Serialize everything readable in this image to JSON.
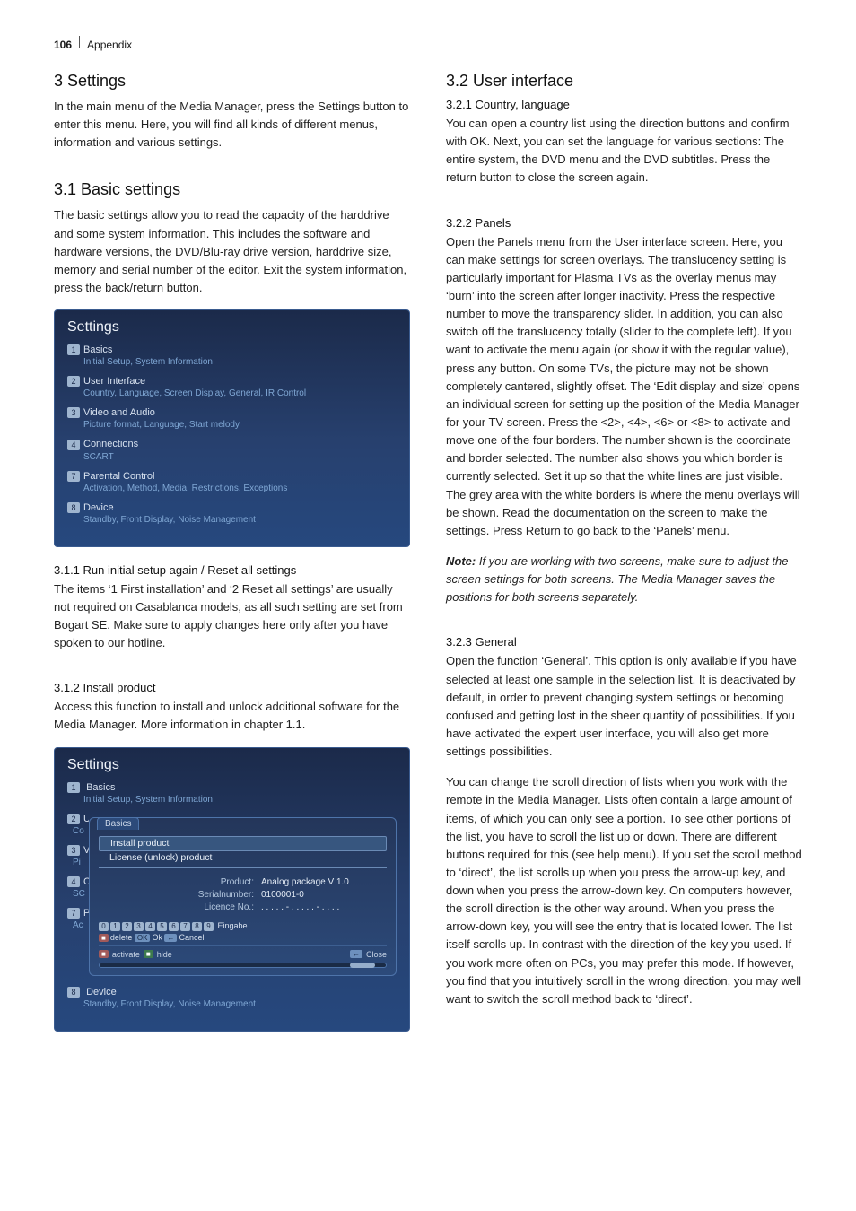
{
  "header": {
    "page_no": "106",
    "section": "Appendix"
  },
  "left": {
    "h_settings": "3 Settings",
    "p_settings": "In the main menu of the Media Manager, press the Settings button to enter this menu. Here, you will find all kinds of different menus, information and various settings.",
    "h_basic": "3.1 Basic settings",
    "p_basic": "The basic settings allow you to read the capacity of the harddrive and some system information. This includes the software and hardware versions, the DVD/Blu-ray drive version, harddrive size, memory and serial number of the editor. Exit the system information, press the back/return button.",
    "panel1": {
      "title": "Settings",
      "items": [
        {
          "num": "1",
          "head": "Basics",
          "sub": "Initial Setup, System Information"
        },
        {
          "num": "2",
          "head": "User Interface",
          "sub": "Country, Language, Screen Display, General, IR Control"
        },
        {
          "num": "3",
          "head": "Video and Audio",
          "sub": "Picture format, Language, Start melody"
        },
        {
          "num": "4",
          "head": "Connections",
          "sub": "SCART"
        },
        {
          "num": "7",
          "head": "Parental Control",
          "sub": "Activation, Method, Media, Restrictions, Exceptions"
        },
        {
          "num": "8",
          "head": "Device",
          "sub": "Standby, Front Display, Noise Management"
        }
      ]
    },
    "h_311": "3.1.1 Run initial setup again / Reset all settings",
    "p_311": "The items ‘1 First installation’ and ‘2 Reset all settings’ are usually not required on Casablanca models, as all such setting are set from Bogart SE. Make sure to apply changes here only after you have spoken to our hotline.",
    "h_312": "3.1.2 Install product",
    "p_312": "Access this function to install and unlock additional software for the Media Manager. More information in chapter 1.1.",
    "panel2": {
      "title": "Settings",
      "item1": {
        "num": "1",
        "head": "Basics",
        "sub": "Initial Setup, System Information"
      },
      "trunc2": {
        "num": "2",
        "headpart": "Us",
        "subpart": "Co"
      },
      "trunc3": {
        "num": "3",
        "headpart": "Vi",
        "subpart": "Pi"
      },
      "trunc4": {
        "num": "4",
        "headpart": "Co",
        "subpart": "SC"
      },
      "trunc7": {
        "num": "7",
        "headpart": "Pa",
        "subpart": "Ac"
      },
      "item8": {
        "num": "8",
        "head": "Device",
        "sub": "Standby, Front Display, Noise Management"
      },
      "dialog": {
        "tab": "Basics",
        "opt1": "Install product",
        "opt2": "License (unlock) product",
        "kv_product_k": "Product:",
        "kv_product_v": "Analog package V 1.0",
        "kv_serial_k": "Serialnumber:",
        "kv_serial_v": "0100001-0",
        "kv_lic_k": "Licence No.:",
        "kv_lic_v": ". . . . . - . . . . . - . . . .",
        "digits": [
          "0",
          "1",
          "2",
          "3",
          "4",
          "5",
          "6",
          "7",
          "8",
          "9"
        ],
        "digits_tail": "Eingabe",
        "row2_delete": "delete",
        "row2_ok": "OK",
        "row2_ok_txt": "Ok",
        "row2_cancel": "Cancel",
        "footer_activate": "activate",
        "footer_hide": "hide",
        "footer_close": "Close"
      }
    }
  },
  "right": {
    "h_ui": "3.2 User interface",
    "h_321": "3.2.1 Country, language",
    "p_321": "You can open a country list using the direction buttons and confirm with OK. Next, you can set the language for various sections: The entire system, the DVD menu and the DVD subtitles. Press the return button to close the screen again.",
    "h_322": "3.2.2 Panels",
    "p_322": "Open the Panels menu from the User interface screen. Here, you can make settings for screen overlays. The translucency setting is particularly important for Plasma TVs as the overlay menus may ‘burn’ into the screen after longer inactivity. Press the respective number to move the transparency slider. In addition, you can also switch off the translucency totally (slider to the complete left). If you want to activate the menu again (or show it with the regular value), press any button. On some TVs, the picture may not be shown completely cantered, slightly offset. The ‘Edit display and size’ opens an individual screen for setting up the position of the Media Manager for your TV screen. Press the <2>, <4>, <6> or <8> to activate and move one of the four borders. The number shown is the coordinate and border selected. The number also shows you which border is currently selected. Set it up so that the white lines are just visible. The grey area with the white borders is where the menu overlays will be shown. Read the documentation on the screen to make the settings. Press Return to go back to the ‘Panels’ menu.",
    "note_label": "Note:",
    "note_body": " If you are working with two screens, make sure to adjust the screen settings for both screens. The Media Manager saves the positions for both screens separately.",
    "h_323": "3.2.3 General",
    "p_323a": "Open the function ‘General’. This option is only available if you have selected at least one sample in the selection list. It is deactivated by default, in order to prevent changing system settings or becoming confused and getting lost in the sheer quantity of possibilities. If you have activated the expert user interface, you will also get more settings possibilities.",
    "p_323b": "You can change the scroll direction of lists when you work with the remote in the Media Manager. Lists often contain a large amount of items, of which you can only see a portion. To see other portions of the list, you have to scroll the list up or down. There are different buttons required for this (see help menu). If you set the scroll method to ‘direct’, the list scrolls up when you press the arrow-up key, and down when you press the arrow-down key. On computers however, the scroll direction is the other way around. When you press the arrow-down key, you will see the entry that is located lower. The list itself scrolls up. In contrast with the direction of the key you used. If you work more often on PCs, you may prefer this mode. If however, you find that you intuitively scroll in the wrong direction, you may well want to switch the scroll method back to ‘direct’."
  }
}
